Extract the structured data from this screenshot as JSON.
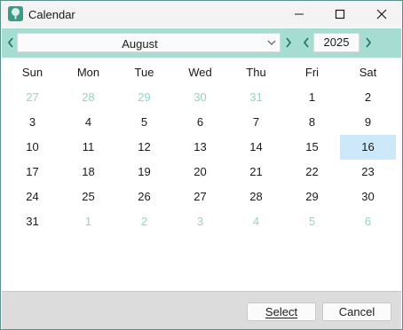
{
  "window": {
    "title": "Calendar"
  },
  "nav": {
    "month": "August",
    "year": "2025"
  },
  "weekdays": [
    "Sun",
    "Mon",
    "Tue",
    "Wed",
    "Thu",
    "Fri",
    "Sat"
  ],
  "weeks": [
    [
      "27",
      "28",
      "29",
      "30",
      "31",
      "1",
      "2"
    ],
    [
      "3",
      "4",
      "5",
      "6",
      "7",
      "8",
      "9"
    ],
    [
      "10",
      "11",
      "12",
      "13",
      "14",
      "15",
      "16"
    ],
    [
      "17",
      "18",
      "19",
      "20",
      "21",
      "22",
      "23"
    ],
    [
      "24",
      "25",
      "26",
      "27",
      "28",
      "29",
      "30"
    ],
    [
      "31",
      "1",
      "2",
      "3",
      "4",
      "5",
      "6"
    ]
  ],
  "selected_day": "16",
  "buttons": {
    "select": "Select",
    "cancel": "Cancel"
  },
  "colors": {
    "nav_bar": "#a6dcd2",
    "arrow": "#1f7a6c",
    "other_month_text": "#8fd5c7",
    "selected_background": "#cde8f8",
    "footer": "#dcdcdc"
  },
  "icons": {
    "app": "tree-icon",
    "minimize": "minimize-icon",
    "maximize": "maximize-icon",
    "close": "close-icon",
    "prev_month": "chevron-left-icon",
    "next_month": "chevron-right-icon",
    "dropdown": "chevron-down-icon",
    "prev_year": "chevron-left-icon",
    "next_year": "chevron-right-icon"
  }
}
